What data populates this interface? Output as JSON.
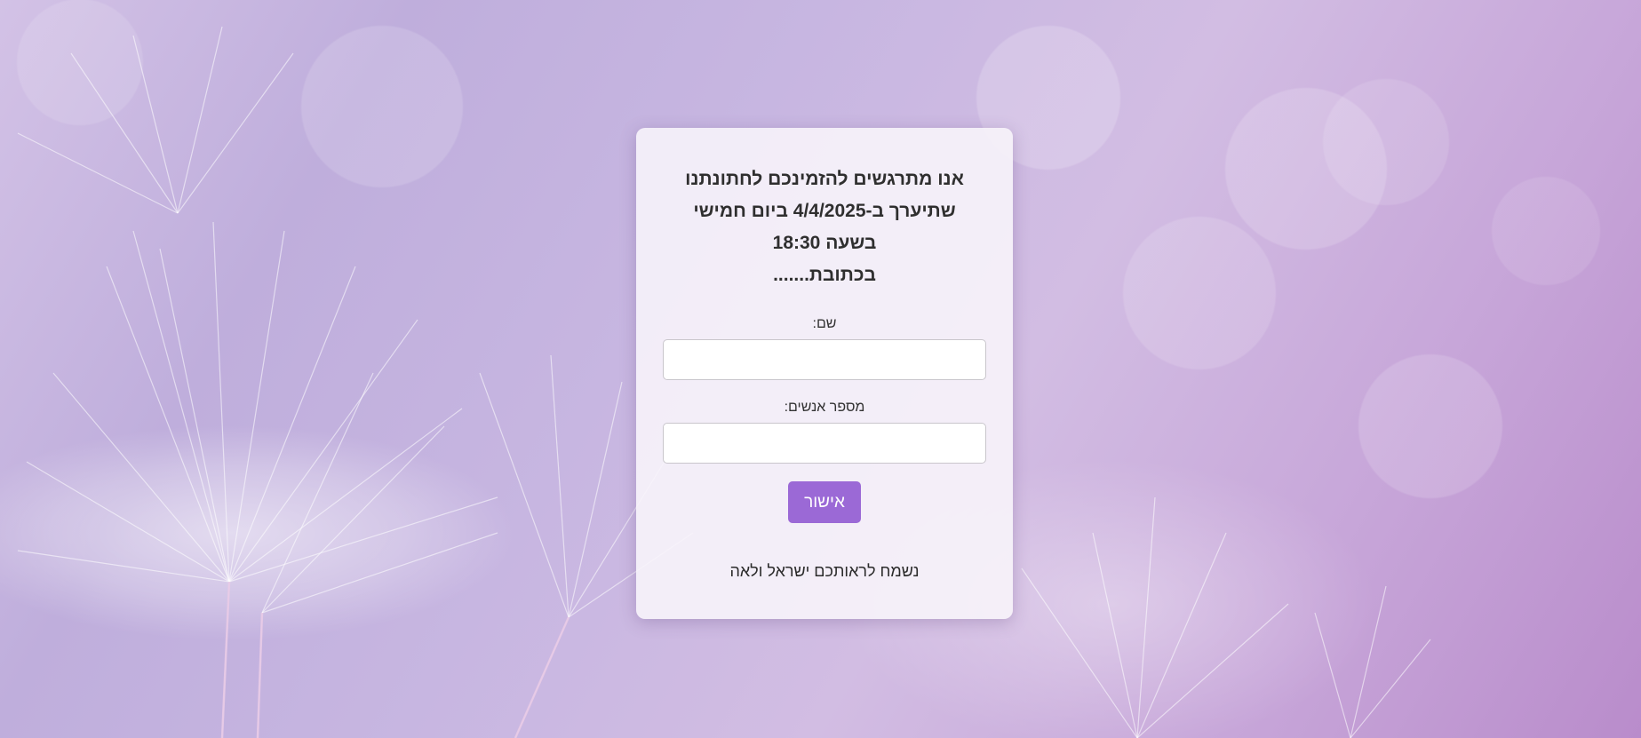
{
  "invitation": {
    "headline_line1": "אנו מתרגשים להזמינכם לחתונתנו",
    "headline_line2": "שתיערך ב-4/4/2025 ביום חמישי",
    "headline_line3": "בשעה 18:30",
    "headline_line4": "בכתובת.......",
    "name_label": "שם:",
    "name_value": "",
    "guests_label": "מספר אנשים:",
    "guests_value": "",
    "submit_label": "אישור",
    "footer_text": "נשמח לראותכם ישראל ולאה"
  },
  "colors": {
    "accent": "#9b69d6",
    "card_background": "#f8f5fa"
  }
}
